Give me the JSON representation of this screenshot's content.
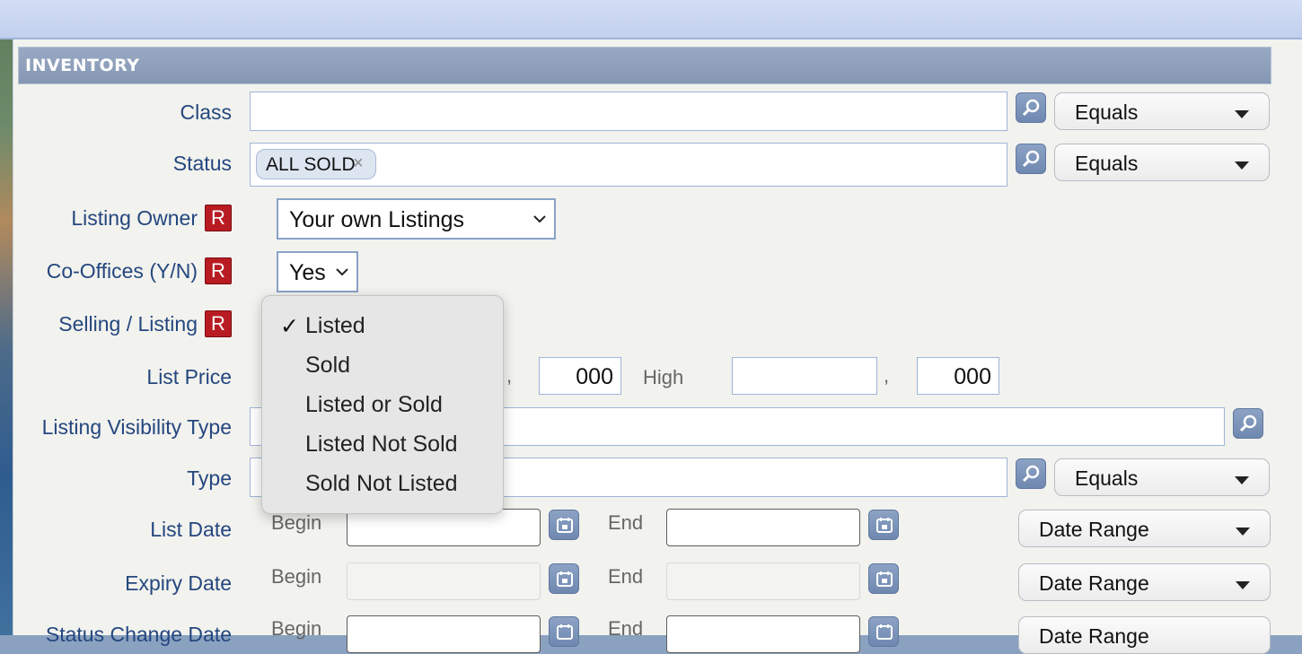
{
  "section": {
    "title": "INVENTORY"
  },
  "fields": {
    "class": {
      "label": "Class",
      "value": "",
      "operator": "Equals"
    },
    "status": {
      "label": "Status",
      "tag": "ALL SOLD",
      "tag_remove": "×",
      "operator": "Equals"
    },
    "listing_owner": {
      "label": "Listing Owner",
      "badge": "R",
      "selected": "Your own Listings"
    },
    "co_offices": {
      "label": "Co-Offices (Y/N)",
      "badge": "R",
      "selected": "Yes"
    },
    "selling_listing": {
      "label": "Selling / Listing",
      "badge": "R"
    },
    "list_price": {
      "label": "List Price",
      "low_thousands": "000",
      "high_label": "High",
      "high_value": "",
      "high_thousands": "000",
      "separator": ","
    },
    "listing_visibility_type": {
      "label": "Listing Visibility Type",
      "value": ""
    },
    "type": {
      "label": "Type",
      "value": "",
      "operator": "Equals"
    },
    "list_date": {
      "label": "List Date",
      "begin_label": "Begin",
      "end_label": "End",
      "begin": "",
      "end": "",
      "operator": "Date Range"
    },
    "expiry_date": {
      "label": "Expiry Date",
      "begin_label": "Begin",
      "end_label": "End",
      "begin": "",
      "end": "",
      "operator": "Date Range"
    },
    "status_change_date": {
      "label": "Status Change Date",
      "begin_label": "Begin",
      "end_label": "End",
      "begin": "",
      "end": "",
      "operator": "Date Range"
    }
  },
  "dropdown": {
    "checkmark": "✓",
    "options": [
      "Listed",
      "Sold",
      "Listed or Sold",
      "Listed Not Sold",
      "Sold Not Listed"
    ],
    "selected": "Listed"
  },
  "icons": {
    "search": "magnifier-icon",
    "calendar": "calendar-icon",
    "caret": "caret-down-icon",
    "chevron": "chevron-down-icon"
  },
  "colors": {
    "label": "#24477f",
    "header": "#8597b2",
    "badge": "#b81c22",
    "panel": "#f2f2ee"
  }
}
